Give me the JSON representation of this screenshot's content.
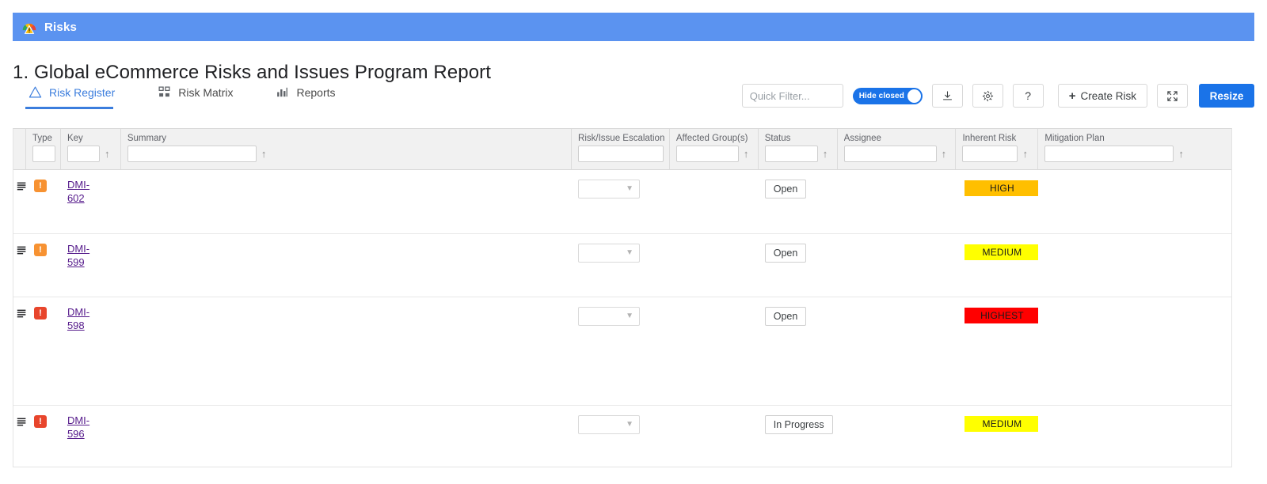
{
  "app": {
    "banner_title": "Risks",
    "banner_icon": "risk-gauge-icon",
    "banner_color": "#5b93f0"
  },
  "page": {
    "title": "1. Global eCommerce Risks and Issues Program Report"
  },
  "tabs": [
    {
      "label": "Risk Register",
      "icon": "warning-triangle-icon",
      "active": true
    },
    {
      "label": "Risk Matrix",
      "icon": "grid-matrix-icon",
      "active": false
    },
    {
      "label": "Reports",
      "icon": "bar-chart-icon",
      "active": false
    }
  ],
  "toolbar": {
    "quick_filter_placeholder": "Quick Filter...",
    "quick_filter_value": "",
    "hide_closed_label": "Hide closed",
    "hide_closed_on": true,
    "export_icon": "download-icon",
    "settings_icon": "gear-icon",
    "help_label": "?",
    "create_risk_label": "Create Risk",
    "create_risk_plus": "+",
    "collapse_icon": "collapse-arrows-icon",
    "resize_label": "Resize",
    "accent_color": "#1a73e8"
  },
  "grid": {
    "columns": [
      {
        "key": "drag",
        "label": "",
        "filter": false,
        "sort": false
      },
      {
        "key": "type",
        "label": "Type",
        "filter": true,
        "sort": false
      },
      {
        "key": "key",
        "label": "Key",
        "filter": true,
        "sort": true
      },
      {
        "key": "summary",
        "label": "Summary",
        "filter": true,
        "sort": true
      },
      {
        "key": "esc",
        "label": "Risk/Issue Escalation Lev",
        "filter": true,
        "sort": false
      },
      {
        "key": "group",
        "label": "Affected Group(s)",
        "filter": true,
        "sort": true
      },
      {
        "key": "status",
        "label": "Status",
        "filter": true,
        "sort": true
      },
      {
        "key": "assignee",
        "label": "Assignee",
        "filter": true,
        "sort": true
      },
      {
        "key": "inherent",
        "label": "Inherent Risk",
        "filter": true,
        "sort": true
      },
      {
        "key": "mitig",
        "label": "Mitigation Plan",
        "filter": true,
        "sort": true
      }
    ],
    "sort_arrow_glyph": "↑",
    "rows": [
      {
        "drag_handle": "drag-handle-icon",
        "priority": "!",
        "priority_color": "orange",
        "key": "DMI-602",
        "summary": "",
        "escalation": "",
        "affected_groups": "",
        "status": "Open",
        "assignee": "",
        "inherent_risk": "HIGH",
        "inherent_risk_color": "#ffbf00",
        "mitigation_plan": ""
      },
      {
        "drag_handle": "drag-handle-icon",
        "priority": "!",
        "priority_color": "orange",
        "key": "DMI-599",
        "summary": "",
        "escalation": "",
        "affected_groups": "",
        "status": "Open",
        "assignee": "",
        "inherent_risk": "MEDIUM",
        "inherent_risk_color": "#ffff00",
        "mitigation_plan": ""
      },
      {
        "drag_handle": "drag-handle-icon",
        "priority": "!",
        "priority_color": "red",
        "key": "DMI-598",
        "summary": "",
        "escalation": "",
        "affected_groups": "",
        "status": "Open",
        "assignee": "",
        "inherent_risk": "HIGHEST",
        "inherent_risk_color": "#ff0000",
        "mitigation_plan": ""
      },
      {
        "drag_handle": "drag-handle-icon",
        "priority": "!",
        "priority_color": "red",
        "key": "DMI-596",
        "summary": "",
        "escalation": "",
        "affected_groups": "",
        "status": "In Progress",
        "assignee": "",
        "inherent_risk": "MEDIUM",
        "inherent_risk_color": "#ffff00",
        "mitigation_plan": ""
      }
    ]
  }
}
